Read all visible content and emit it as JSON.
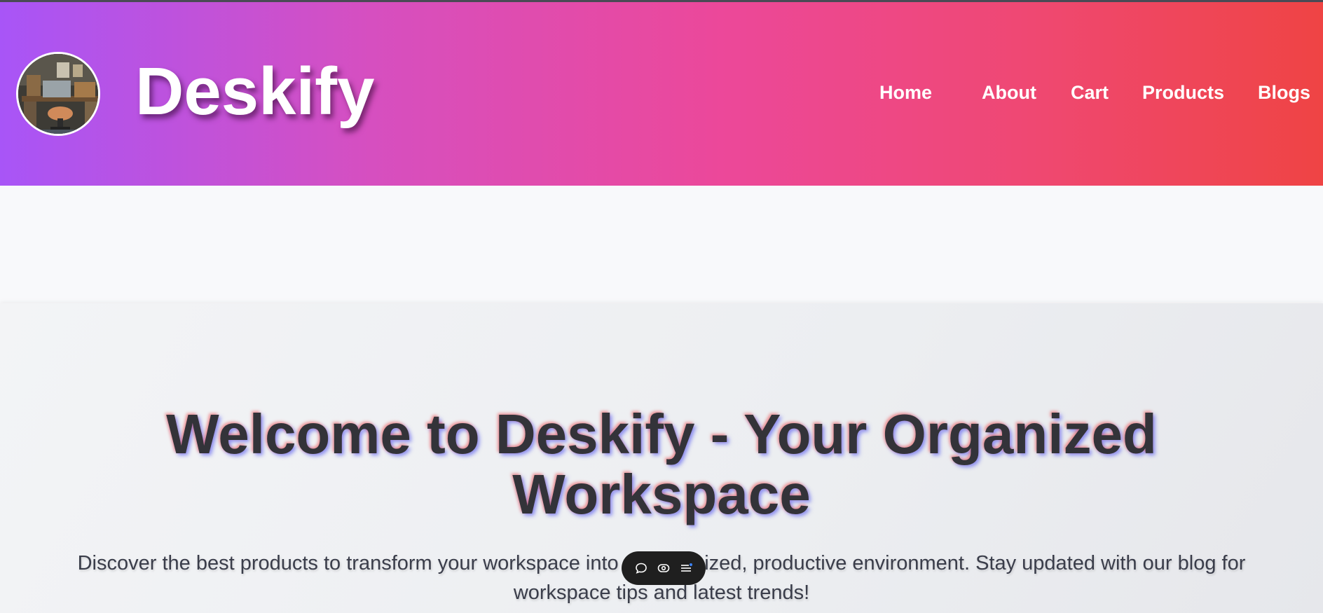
{
  "header": {
    "brand": "Deskify",
    "logo_icon": "desk-workspace-photo-icon",
    "nav": [
      {
        "label": "Home"
      },
      {
        "label": "About"
      },
      {
        "label": "Cart"
      },
      {
        "label": "Products"
      },
      {
        "label": "Blogs"
      }
    ],
    "gradient": [
      "#a855f7",
      "#ec4899",
      "#ef4444"
    ]
  },
  "hero": {
    "title_line1": "Welcome to Deskify - Your Organized",
    "title_line2": "Workspace",
    "text_line1": "Discover the best products to transform your workspace into an organized, productive environment. Stay updated with our blog for",
    "text_line2": "workspace tips and latest trends!"
  },
  "toolbar": {
    "icons": [
      "comment-icon",
      "eye-icon",
      "menu-icon"
    ]
  }
}
